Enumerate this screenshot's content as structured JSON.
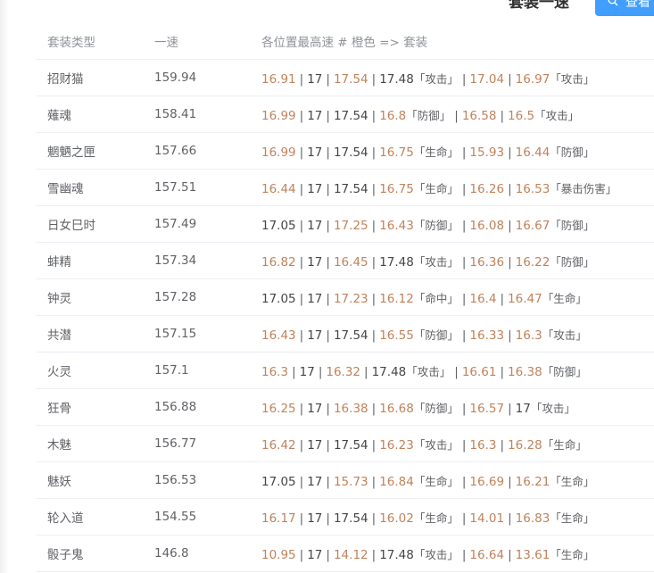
{
  "top": {
    "title": "套装一速",
    "button_label": "查看"
  },
  "table": {
    "headers": [
      "套装类型",
      "一速",
      "各位置最高速 # 橙色 => 套装"
    ],
    "rows": [
      {
        "name": "招财猫",
        "speed": "159.94",
        "segs": [
          {
            "v": "16.91",
            "c": "o",
            "t": ""
          },
          {
            "v": "17",
            "c": "b",
            "t": ""
          },
          {
            "v": "17.54",
            "c": "o",
            "t": ""
          },
          {
            "v": "17.48",
            "c": "b",
            "t": "「攻击」"
          },
          {
            "v": "17.04",
            "c": "o",
            "t": ""
          },
          {
            "v": "16.97",
            "c": "o",
            "t": "「攻击」"
          }
        ]
      },
      {
        "name": "薙魂",
        "speed": "158.41",
        "segs": [
          {
            "v": "16.99",
            "c": "o",
            "t": ""
          },
          {
            "v": "17",
            "c": "b",
            "t": ""
          },
          {
            "v": "17.54",
            "c": "b",
            "t": ""
          },
          {
            "v": "16.8",
            "c": "o",
            "t": "「防御」"
          },
          {
            "v": "16.58",
            "c": "o",
            "t": ""
          },
          {
            "v": "16.5",
            "c": "o",
            "t": "「攻击」"
          }
        ]
      },
      {
        "name": "魍魉之匣",
        "speed": "157.66",
        "segs": [
          {
            "v": "16.99",
            "c": "o",
            "t": ""
          },
          {
            "v": "17",
            "c": "b",
            "t": ""
          },
          {
            "v": "17.54",
            "c": "b",
            "t": ""
          },
          {
            "v": "16.75",
            "c": "o",
            "t": "「生命」"
          },
          {
            "v": "15.93",
            "c": "o",
            "t": ""
          },
          {
            "v": "16.44",
            "c": "o",
            "t": "「防御」"
          }
        ]
      },
      {
        "name": "雪幽魂",
        "speed": "157.51",
        "segs": [
          {
            "v": "16.44",
            "c": "o",
            "t": ""
          },
          {
            "v": "17",
            "c": "b",
            "t": ""
          },
          {
            "v": "17.54",
            "c": "b",
            "t": ""
          },
          {
            "v": "16.75",
            "c": "o",
            "t": "「生命」"
          },
          {
            "v": "16.26",
            "c": "o",
            "t": ""
          },
          {
            "v": "16.53",
            "c": "o",
            "t": "「暴击伤害」"
          }
        ]
      },
      {
        "name": "日女巳时",
        "speed": "157.49",
        "segs": [
          {
            "v": "17.05",
            "c": "b",
            "t": ""
          },
          {
            "v": "17",
            "c": "b",
            "t": ""
          },
          {
            "v": "17.25",
            "c": "o",
            "t": ""
          },
          {
            "v": "16.43",
            "c": "o",
            "t": "「防御」"
          },
          {
            "v": "16.08",
            "c": "o",
            "t": ""
          },
          {
            "v": "16.67",
            "c": "o",
            "t": "「防御」"
          }
        ]
      },
      {
        "name": "蚌精",
        "speed": "157.34",
        "segs": [
          {
            "v": "16.82",
            "c": "o",
            "t": ""
          },
          {
            "v": "17",
            "c": "b",
            "t": ""
          },
          {
            "v": "16.45",
            "c": "o",
            "t": ""
          },
          {
            "v": "17.48",
            "c": "b",
            "t": "「攻击」"
          },
          {
            "v": "16.36",
            "c": "o",
            "t": ""
          },
          {
            "v": "16.22",
            "c": "o",
            "t": "「防御」"
          }
        ]
      },
      {
        "name": "钟灵",
        "speed": "157.28",
        "segs": [
          {
            "v": "17.05",
            "c": "b",
            "t": ""
          },
          {
            "v": "17",
            "c": "b",
            "t": ""
          },
          {
            "v": "17.23",
            "c": "o",
            "t": ""
          },
          {
            "v": "16.12",
            "c": "o",
            "t": "「命中」"
          },
          {
            "v": "16.4",
            "c": "o",
            "t": ""
          },
          {
            "v": "16.47",
            "c": "o",
            "t": "「生命」"
          }
        ]
      },
      {
        "name": "共潜",
        "speed": "157.15",
        "segs": [
          {
            "v": "16.43",
            "c": "o",
            "t": ""
          },
          {
            "v": "17",
            "c": "b",
            "t": ""
          },
          {
            "v": "17.54",
            "c": "b",
            "t": ""
          },
          {
            "v": "16.55",
            "c": "o",
            "t": "「防御」"
          },
          {
            "v": "16.33",
            "c": "o",
            "t": ""
          },
          {
            "v": "16.3",
            "c": "o",
            "t": "「攻击」"
          }
        ]
      },
      {
        "name": "火灵",
        "speed": "157.1",
        "segs": [
          {
            "v": "16.3",
            "c": "o",
            "t": ""
          },
          {
            "v": "17",
            "c": "b",
            "t": ""
          },
          {
            "v": "16.32",
            "c": "o",
            "t": ""
          },
          {
            "v": "17.48",
            "c": "b",
            "t": "「攻击」"
          },
          {
            "v": "16.61",
            "c": "o",
            "t": ""
          },
          {
            "v": "16.38",
            "c": "o",
            "t": "「防御」"
          }
        ]
      },
      {
        "name": "狂骨",
        "speed": "156.88",
        "segs": [
          {
            "v": "16.25",
            "c": "o",
            "t": ""
          },
          {
            "v": "17",
            "c": "b",
            "t": ""
          },
          {
            "v": "16.38",
            "c": "o",
            "t": ""
          },
          {
            "v": "16.68",
            "c": "o",
            "t": "「防御」"
          },
          {
            "v": "16.57",
            "c": "o",
            "t": ""
          },
          {
            "v": "17",
            "c": "b",
            "t": "「攻击」"
          }
        ]
      },
      {
        "name": "木魅",
        "speed": "156.77",
        "segs": [
          {
            "v": "16.42",
            "c": "o",
            "t": ""
          },
          {
            "v": "17",
            "c": "b",
            "t": ""
          },
          {
            "v": "17.54",
            "c": "b",
            "t": ""
          },
          {
            "v": "16.23",
            "c": "o",
            "t": "「攻击」"
          },
          {
            "v": "16.3",
            "c": "o",
            "t": ""
          },
          {
            "v": "16.28",
            "c": "o",
            "t": "「生命」"
          }
        ]
      },
      {
        "name": "魅妖",
        "speed": "156.53",
        "segs": [
          {
            "v": "17.05",
            "c": "b",
            "t": ""
          },
          {
            "v": "17",
            "c": "b",
            "t": ""
          },
          {
            "v": "15.73",
            "c": "o",
            "t": ""
          },
          {
            "v": "16.84",
            "c": "o",
            "t": "「生命」"
          },
          {
            "v": "16.69",
            "c": "o",
            "t": ""
          },
          {
            "v": "16.21",
            "c": "o",
            "t": "「生命」"
          }
        ]
      },
      {
        "name": "轮入道",
        "speed": "154.55",
        "segs": [
          {
            "v": "16.17",
            "c": "o",
            "t": ""
          },
          {
            "v": "17",
            "c": "b",
            "t": ""
          },
          {
            "v": "17.54",
            "c": "b",
            "t": ""
          },
          {
            "v": "16.02",
            "c": "o",
            "t": "「生命」"
          },
          {
            "v": "14.01",
            "c": "o",
            "t": ""
          },
          {
            "v": "16.83",
            "c": "o",
            "t": "「生命」"
          }
        ]
      },
      {
        "name": "骰子鬼",
        "speed": "146.8",
        "segs": [
          {
            "v": "10.95",
            "c": "o",
            "t": ""
          },
          {
            "v": "17",
            "c": "b",
            "t": ""
          },
          {
            "v": "14.12",
            "c": "o",
            "t": ""
          },
          {
            "v": "17.48",
            "c": "b",
            "t": "「攻击」"
          },
          {
            "v": "16.64",
            "c": "o",
            "t": ""
          },
          {
            "v": "13.61",
            "c": "o",
            "t": "「生命」"
          }
        ]
      }
    ]
  }
}
